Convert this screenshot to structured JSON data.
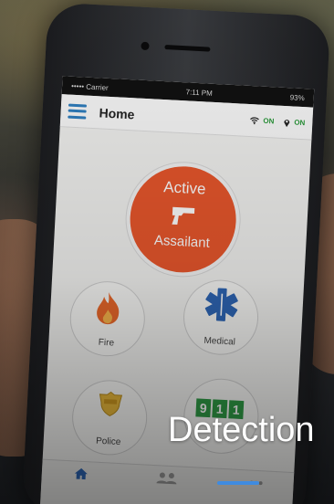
{
  "status_bar": {
    "carrier": "••••• Carrier",
    "time": "7:11 PM",
    "battery": "93%"
  },
  "app_bar": {
    "title": "Home",
    "wifi_status": "ON",
    "location_status": "ON"
  },
  "main_button": {
    "line1": "Active",
    "line2": "Assailant",
    "icon": "gun-icon",
    "color": "#e9572c"
  },
  "emergency_buttons": [
    {
      "label": "Fire",
      "icon": "fire-icon"
    },
    {
      "label": "Medical",
      "icon": "star-of-life-icon"
    },
    {
      "label": "Police",
      "icon": "police-badge-icon"
    },
    {
      "label": "",
      "icon": "911-icon"
    }
  ],
  "emergency_911": [
    "9",
    "1",
    "1"
  ],
  "caption": "Detection",
  "colors": {
    "accent": "#3f8be0",
    "status_on": "#2a9a3a",
    "menu": "#2f7fc0"
  }
}
